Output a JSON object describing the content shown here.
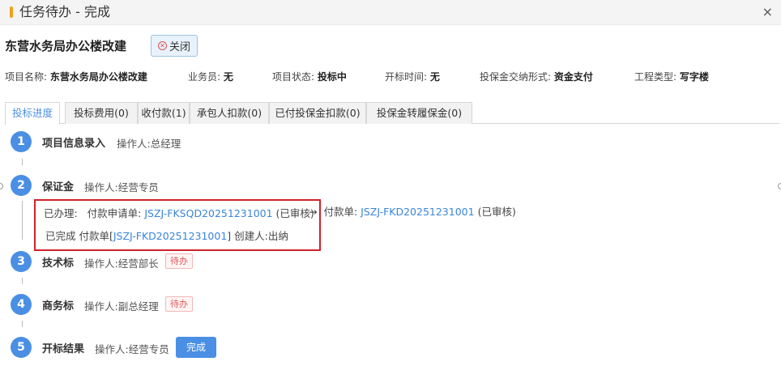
{
  "header": {
    "title": "任务待办 - 完成",
    "close_icon": "×"
  },
  "project": {
    "title": "东营水务局办公楼改建",
    "close_button": "关闭"
  },
  "info": [
    {
      "label": "项目名称:",
      "value": "东营水务局办公楼改建"
    },
    {
      "label": "业务员:",
      "value": "无"
    },
    {
      "label": "项目状态:",
      "value": "投标中"
    },
    {
      "label": "开标时间:",
      "value": "无"
    },
    {
      "label": "投保金交纳形式:",
      "value": "资金支付"
    },
    {
      "label": "工程类型:",
      "value": "写字楼"
    }
  ],
  "tabs": [
    "投标进度",
    "投标费用(0)",
    "收付款(1)",
    "承包人扣款(0)",
    "已付投保金扣款(0)",
    "投保金转履保金(0)"
  ],
  "steps": [
    {
      "num": "1",
      "title": "项目信息录入",
      "operator": "操作人:总经理"
    },
    {
      "num": "2",
      "title": "保证金",
      "operator": "操作人:经营专员"
    },
    {
      "num": "3",
      "title": "技术标",
      "operator": "操作人:经营部长",
      "tag": "待办"
    },
    {
      "num": "4",
      "title": "商务标",
      "operator": "操作人:副总经理",
      "tag": "待办"
    },
    {
      "num": "5",
      "title": "开标结果",
      "operator": "操作人:经营专员",
      "button": "完成"
    }
  ],
  "deposit_detail": {
    "done_label": "已办理:",
    "apply_label": "付款申请单:",
    "apply_code": "JSZJ-FKSQD20251231001",
    "apply_status": "(已审核)",
    "arrow": "→",
    "pay_label": "付款单:",
    "pay_code": "JSZJ-FKD20251231001",
    "pay_status": "(已审核)",
    "completed_prefix": "已完成 付款单[",
    "completed_code": "JSZJ-FKD20251231001",
    "completed_suffix": "] 创建人:出纳"
  },
  "colors": {
    "accent": "#4a8fe4",
    "link": "#3a86d9",
    "highlight_border": "#d2222a",
    "pending_tag": "#e05a5a"
  }
}
